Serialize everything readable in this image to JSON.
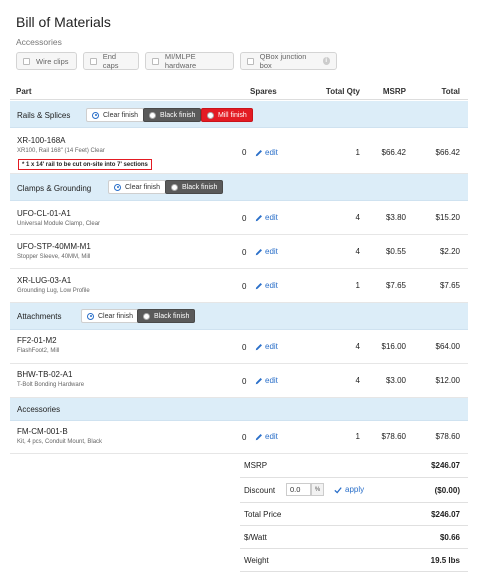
{
  "page": {
    "title": "Bill of Materials",
    "subtitle": "Accessories"
  },
  "accessories": [
    {
      "label": "Wire clips",
      "checked": false
    },
    {
      "label": "End caps",
      "checked": false
    },
    {
      "label": "MI/MLPE hardware",
      "checked": false
    },
    {
      "label": "QBox junction box",
      "checked": false,
      "info": true
    }
  ],
  "columns": {
    "part": "Part",
    "spares": "Spares",
    "total_qty": "Total Qty",
    "msrp": "MSRP",
    "total": "Total"
  },
  "sections": {
    "rails": {
      "title": "Rails & Splices",
      "options": [
        "Clear finish",
        "Black finish",
        "Mill finish"
      ],
      "selected": "Clear finish"
    },
    "clamps": {
      "title": "Clamps & Grounding",
      "options": [
        "Clear finish",
        "Black finish"
      ],
      "selected": "Clear finish"
    },
    "attach": {
      "title": "Attachments",
      "options": [
        "Clear finish",
        "Black finish"
      ],
      "selected": "Clear finish"
    },
    "acc": {
      "title": "Accessories"
    }
  },
  "items": {
    "xr100": {
      "part": "XR-100-168A",
      "desc": "XR100, Rail 168\" (14 Feet) Clear",
      "note": "* 1 x 14' rail to be cut on-site into 7' sections",
      "spares": "0",
      "edit": "edit",
      "qty": "1",
      "msrp": "$66.42",
      "total": "$66.42"
    },
    "ufocl": {
      "part": "UFO-CL-01-A1",
      "desc": "Universal Module Clamp, Clear",
      "spares": "0",
      "edit": "edit",
      "qty": "4",
      "msrp": "$3.80",
      "total": "$15.20"
    },
    "ufostp": {
      "part": "UFO-STP-40MM-M1",
      "desc": "Stopper Sleeve, 40MM, Mill",
      "spares": "0",
      "edit": "edit",
      "qty": "4",
      "msrp": "$0.55",
      "total": "$2.20"
    },
    "xrlug": {
      "part": "XR-LUG-03-A1",
      "desc": "Grounding Lug, Low Profile",
      "spares": "0",
      "edit": "edit",
      "qty": "1",
      "msrp": "$7.65",
      "total": "$7.65"
    },
    "ff2": {
      "part": "FF2-01-M2",
      "desc": "FlashFoot2, Mill",
      "spares": "0",
      "edit": "edit",
      "qty": "4",
      "msrp": "$16.00",
      "total": "$64.00"
    },
    "bhw": {
      "part": "BHW-TB-02-A1",
      "desc": "T-Bolt Bonding Hardware",
      "spares": "0",
      "edit": "edit",
      "qty": "4",
      "msrp": "$3.00",
      "total": "$12.00"
    },
    "fmcm": {
      "part": "FM-CM-001-B",
      "desc": "Kit, 4 pcs, Conduit Mount, Black",
      "spares": "0",
      "edit": "edit",
      "qty": "1",
      "msrp": "$78.60",
      "total": "$78.60"
    }
  },
  "summary": {
    "msrp_label": "MSRP",
    "msrp_value": "$246.07",
    "discount_label": "Discount",
    "discount_value": "0.0",
    "discount_unit": "%",
    "apply_label": "apply",
    "discount_amount": "($0.00)",
    "total_label": "Total Price",
    "total_value": "$246.07",
    "watt_label": "$/Watt",
    "watt_value": "$0.66",
    "weight_label": "Weight",
    "weight_value": "19.5 lbs"
  },
  "colors": {
    "section_bg": "#dcedf8",
    "link": "#2a6fc9",
    "mill": "#e31b23",
    "black_pill": "#5a5a5a"
  }
}
